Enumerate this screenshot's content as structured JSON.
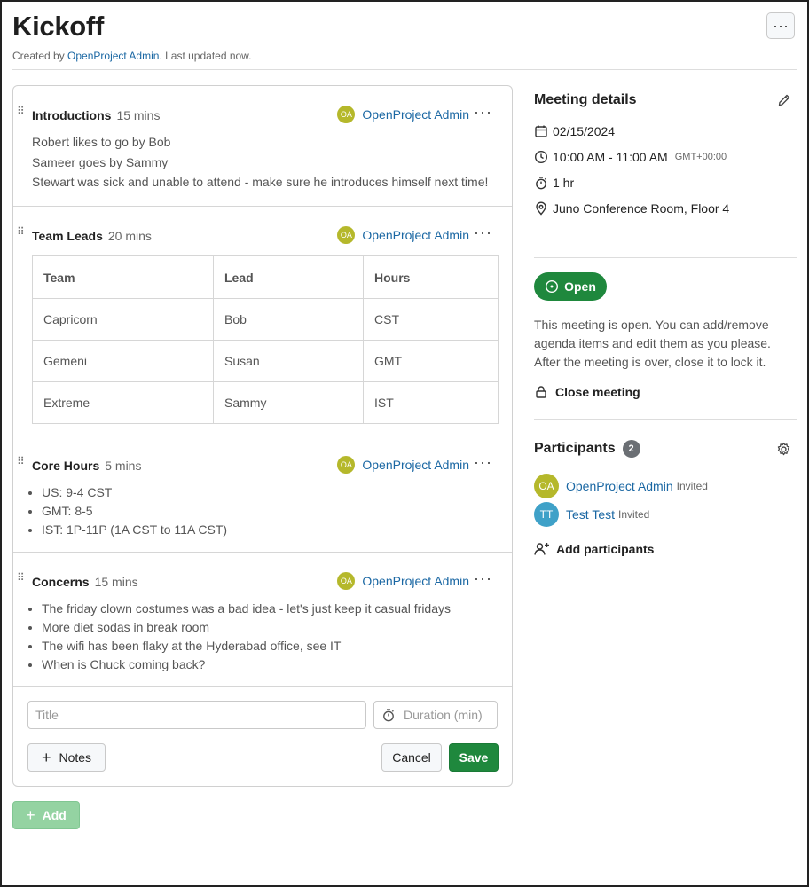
{
  "page": {
    "title": "Kickoff",
    "created_by_prefix": "Created by",
    "created_by_user": "OpenProject Admin",
    "updated_text": ". Last updated now."
  },
  "agenda": {
    "items": [
      {
        "title": "Introductions",
        "duration": "15 mins",
        "owner_initials": "OA",
        "owner": "OpenProject Admin",
        "notes": [
          "Robert likes to go by Bob",
          "Sameer goes by Sammy",
          "Stewart was sick and unable to attend - make sure he introduces himself next time!"
        ]
      },
      {
        "title": "Team Leads",
        "duration": "20 mins",
        "owner_initials": "OA",
        "owner": "OpenProject Admin",
        "table": {
          "headers": [
            "Team",
            "Lead",
            "Hours"
          ],
          "rows": [
            [
              "Capricorn",
              "Bob",
              "CST"
            ],
            [
              "Gemeni",
              "Susan",
              "GMT"
            ],
            [
              "Extreme",
              "Sammy",
              "IST"
            ]
          ]
        }
      },
      {
        "title": "Core Hours",
        "duration": "5 mins",
        "owner_initials": "OA",
        "owner": "OpenProject Admin",
        "bullets": [
          "US: 9-4 CST",
          "GMT: 8-5",
          "IST: 1P-11P (1A CST to 11A CST)"
        ]
      },
      {
        "title": "Concerns",
        "duration": "15 mins",
        "owner_initials": "OA",
        "owner": "OpenProject Admin",
        "bullets": [
          "The friday clown costumes was a bad idea - let's just keep it casual fridays",
          "More diet sodas in break room",
          "The wifi has been flaky at the Hyderabad office, see IT",
          "When is Chuck coming back?"
        ]
      }
    ],
    "form": {
      "title_placeholder": "Title",
      "duration_placeholder": "Duration (min)",
      "notes_label": "Notes",
      "cancel_label": "Cancel",
      "save_label": "Save"
    },
    "add_label": "Add"
  },
  "details": {
    "heading": "Meeting details",
    "date": "02/15/2024",
    "time": "10:00 AM - 11:00 AM",
    "timezone": "GMT+00:00",
    "duration": "1 hr",
    "location": "Juno Conference Room, Floor 4",
    "status_label": "Open",
    "status_description": "This meeting is open. You can add/remove agenda items and edit them as you please. After the meeting is over, close it to lock it.",
    "close_label": "Close meeting"
  },
  "participants": {
    "heading": "Participants",
    "count": "2",
    "list": [
      {
        "initials": "OA",
        "name": "OpenProject Admin",
        "status": "Invited",
        "color": "#b5b82b"
      },
      {
        "initials": "TT",
        "name": "Test Test",
        "status": "Invited",
        "color": "#3fa1c8"
      }
    ],
    "add_label": "Add participants"
  },
  "colors": {
    "accent_green": "#1f883d",
    "link_blue": "#1a67a3"
  }
}
